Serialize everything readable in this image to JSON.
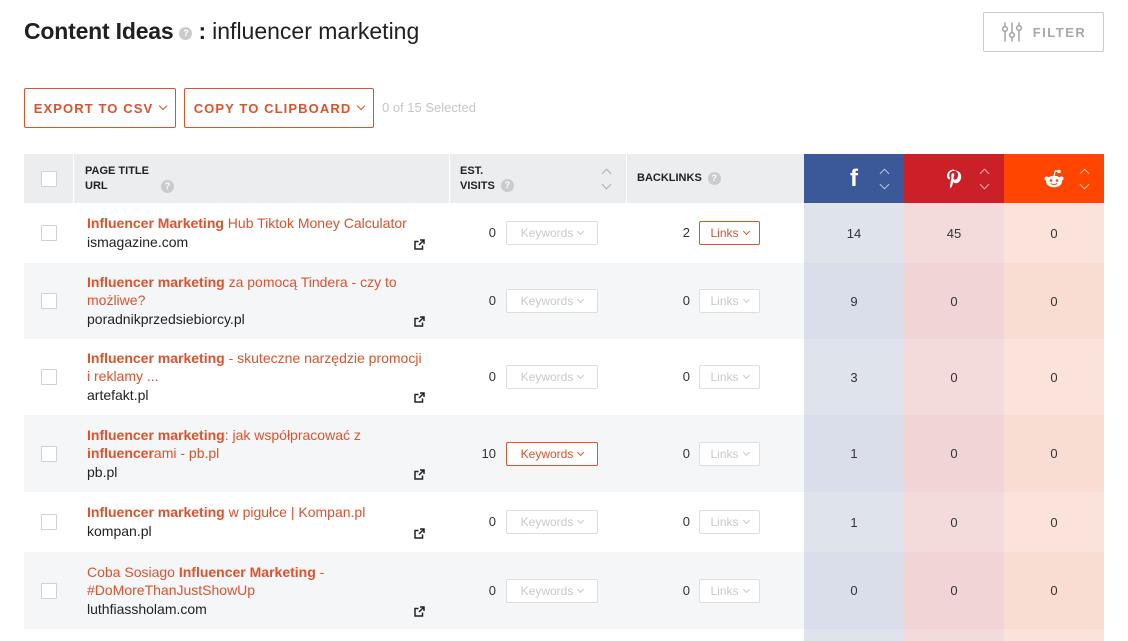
{
  "header": {
    "title": "Content Ideas",
    "help": "?",
    "colon": ":",
    "query": "influencer marketing",
    "filter_label": "FILTER"
  },
  "actions": {
    "export_label": "EXPORT TO CSV",
    "copy_label": "COPY TO CLIPBOARD",
    "selected_text": "0 of 15 Selected"
  },
  "table": {
    "columns": {
      "page_title": "PAGE TITLE",
      "url": "URL",
      "est": "EST.",
      "visits": "VISITS",
      "backlinks": "BACKLINKS"
    },
    "social": {
      "facebook_color": "#3b5998",
      "pinterest_color": "#cb2027",
      "reddit_color": "#ff4500",
      "facebook_glyph": "f",
      "pinterest_glyph": "P",
      "reddit_glyph": "◉"
    },
    "keywords_label": "Keywords",
    "links_label": "Links",
    "rows": [
      {
        "title": [
          {
            "t": "Influencer Marketing",
            "b": true
          },
          {
            "t": " Hub Tiktok Money Calculator",
            "b": false
          }
        ],
        "url": "ismagazine.com",
        "visits": "0",
        "keywords_active": false,
        "backlinks": "2",
        "links_active": true,
        "facebook": "14",
        "pinterest": "45",
        "reddit": "0"
      },
      {
        "title": [
          {
            "t": "Influencer marketing",
            "b": true
          },
          {
            "t": " za pomocą Tindera - czy to możliwe?",
            "b": false
          }
        ],
        "url": "poradnikprzedsiebiorcy.pl",
        "visits": "0",
        "keywords_active": false,
        "backlinks": "0",
        "links_active": false,
        "facebook": "9",
        "pinterest": "0",
        "reddit": "0"
      },
      {
        "title": [
          {
            "t": "Influencer marketing",
            "b": true
          },
          {
            "t": " - skuteczne narzędzie promocji i reklamy ...",
            "b": false
          }
        ],
        "url": "artefakt.pl",
        "visits": "0",
        "keywords_active": false,
        "backlinks": "0",
        "links_active": false,
        "facebook": "3",
        "pinterest": "0",
        "reddit": "0"
      },
      {
        "title": [
          {
            "t": "Influencer marketing",
            "b": true
          },
          {
            "t": ": jak współpracować z ",
            "b": false
          },
          {
            "t": "influencer",
            "b": true
          },
          {
            "t": "ami - pb.pl",
            "b": false
          }
        ],
        "url": "pb.pl",
        "visits": "10",
        "keywords_active": true,
        "backlinks": "0",
        "links_active": false,
        "facebook": "1",
        "pinterest": "0",
        "reddit": "0"
      },
      {
        "title": [
          {
            "t": "Influencer marketing",
            "b": true
          },
          {
            "t": " w pigułce | Kompan.pl",
            "b": false
          }
        ],
        "url": "kompan.pl",
        "visits": "0",
        "keywords_active": false,
        "backlinks": "0",
        "links_active": false,
        "facebook": "1",
        "pinterest": "0",
        "reddit": "0"
      },
      {
        "title": [
          {
            "t": "Coba Sosiago ",
            "b": false
          },
          {
            "t": "Influencer Marketing",
            "b": true
          },
          {
            "t": " - #DoMoreThanJustShowUp",
            "b": false
          }
        ],
        "url": "luthfiassholam.com",
        "visits": "0",
        "keywords_active": false,
        "backlinks": "0",
        "links_active": false,
        "facebook": "0",
        "pinterest": "0",
        "reddit": "0"
      }
    ]
  }
}
